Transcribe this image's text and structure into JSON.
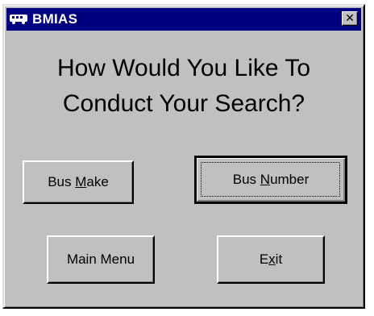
{
  "window": {
    "title": "BMIAS",
    "icon": "bus-icon",
    "close_glyph": "✕"
  },
  "heading": {
    "line1": "How Would You Like To",
    "line2": "Conduct Your Search?"
  },
  "buttons": {
    "bus_make": {
      "pre": "Bus ",
      "mnemonic": "M",
      "post": "ake"
    },
    "bus_number": {
      "pre": "Bus ",
      "mnemonic": "N",
      "post": "umber"
    },
    "main_menu": {
      "pre": "Main Menu",
      "mnemonic": "",
      "post": ""
    },
    "exit": {
      "pre": "E",
      "mnemonic": "x",
      "post": "it"
    }
  },
  "colors": {
    "titlebar": "#000080",
    "face": "#c0c0c0"
  }
}
